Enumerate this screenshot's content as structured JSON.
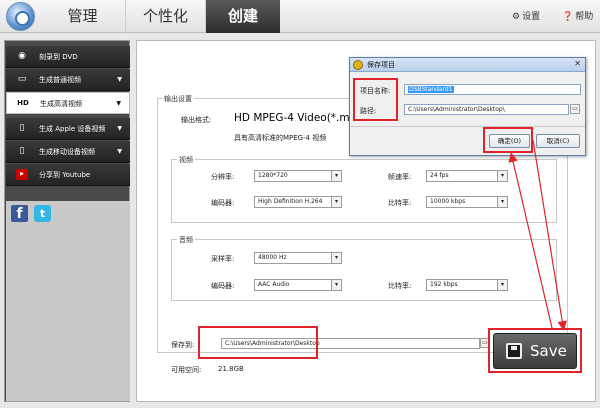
{
  "topbar": {
    "tabs": [
      {
        "label": "管理"
      },
      {
        "label": "个性化"
      },
      {
        "label": "创建"
      }
    ],
    "settings_label": "设置",
    "help_label": "帮助"
  },
  "sidebar": {
    "items": [
      {
        "label": "刻录到 DVD",
        "icon": "disc-icon"
      },
      {
        "label": "生成普通视频",
        "icon": "monitor-icon"
      },
      {
        "label": "生成高清视频",
        "icon": "hd-icon"
      },
      {
        "label": "生成 Apple 设备视频",
        "icon": "phone-icon"
      },
      {
        "label": "生成移动设备视频",
        "icon": "mobile-icon"
      },
      {
        "label": "分享到 Youtube",
        "icon": "youtube-icon"
      }
    ]
  },
  "output": {
    "section_label": "输出设置",
    "format_label": "输出格式:",
    "format_value": "HD MPEG-4 Video(*.mp4)",
    "format_desc": "具有高清标准的MPEG-4 视频"
  },
  "video": {
    "section_label": "视频",
    "resolution_label": "分辨率:",
    "resolution_value": "1280*720",
    "framerate_label": "帧速率:",
    "framerate_value": "24 fps",
    "encoder_label": "编码器:",
    "encoder_value": "High Definition H.264",
    "bitrate_label": "比特率:",
    "bitrate_value": "10000 kbps"
  },
  "audio": {
    "section_label": "音频",
    "samplerate_label": "采样率:",
    "samplerate_value": "48000 Hz",
    "encoder_label": "编码器:",
    "encoder_value": "AAC Audio",
    "bitrate_label": "比特率:",
    "bitrate_value": "192 kbps"
  },
  "save": {
    "save_to_label": "保存到:",
    "save_to_value": "C:\\Users\\Administrator\\Desktop",
    "free_space_label": "可用空间:",
    "free_space_value": "21.8GB",
    "save_button_label": "Save"
  },
  "dialog": {
    "title": "保存项目",
    "project_name_label": "项目名称:",
    "project_name_value": "DSBStandard1",
    "path_label": "路径:",
    "path_value": "C:\\Users\\Administrator\\Desktop\\",
    "ok_label": "确定(O)",
    "cancel_label": "取消(C)"
  },
  "colors": {
    "highlight_red": "#e0242c",
    "active_tab": "#2d2d2d",
    "sidebar_dark": "#232323"
  }
}
